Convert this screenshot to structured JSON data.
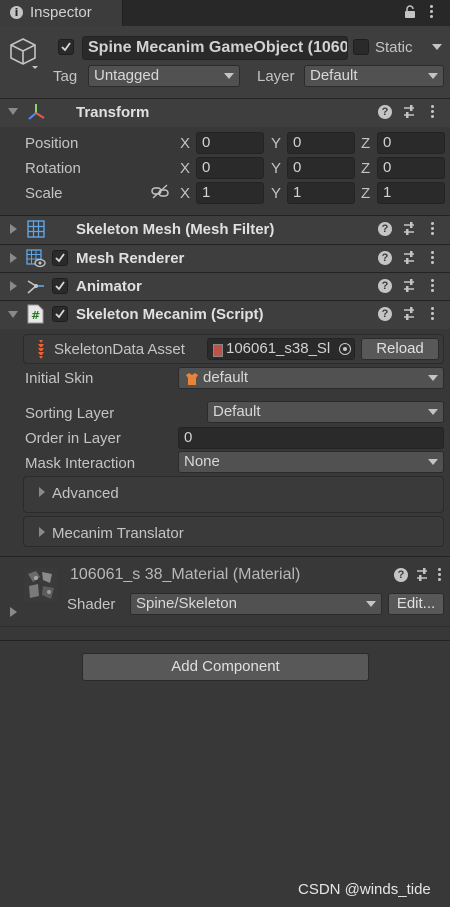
{
  "tab": {
    "title": "Inspector",
    "icon": "info-icon"
  },
  "tab_controls": {
    "lock_icon": "lock-icon",
    "menu_icon": "kebab-menu-icon"
  },
  "gameobject": {
    "name": "Spine Mecanim GameObject (1060",
    "static_label": "Static",
    "tag_label": "Tag",
    "tag_value": "Untagged",
    "layer_label": "Layer",
    "layer_value": "Default"
  },
  "transform": {
    "title": "Transform",
    "position_label": "Position",
    "rotation_label": "Rotation",
    "scale_label": "Scale",
    "x": "X",
    "y": "Y",
    "z": "Z",
    "position": [
      "0",
      "0",
      "0"
    ],
    "rotation": [
      "0",
      "0",
      "0"
    ],
    "scale": [
      "1",
      "1",
      "1"
    ]
  },
  "components": {
    "mesh_filter": "Skeleton Mesh (Mesh Filter)",
    "mesh_renderer": "Mesh Renderer",
    "animator": "Animator",
    "skeleton_mecanim": "Skeleton Mecanim (Script)"
  },
  "skeleton_mecanim": {
    "skeleton_data_label": "SkeletonData Asset",
    "skeleton_data_value": "106061_s38_Sl",
    "reload_label": "Reload",
    "initial_skin_label": "Initial Skin",
    "initial_skin_value": "default",
    "sorting_layer_label": "Sorting Layer",
    "sorting_layer_value": "Default",
    "order_in_layer_label": "Order in Layer",
    "order_in_layer_value": "0",
    "mask_interaction_label": "Mask Interaction",
    "mask_interaction_value": "None",
    "advanced_label": "Advanced",
    "mecanim_translator_label": "Mecanim Translator"
  },
  "material": {
    "title": "106061_s 38_Material (Material)",
    "shader_label": "Shader",
    "shader_value": "Spine/Skeleton",
    "edit_label": "Edit..."
  },
  "add_component_label": "Add Component",
  "watermark": "CSDN @winds_tide",
  "colors": {
    "background": "#383838",
    "header": "#3e3e3e",
    "field": "#2a2a2a",
    "text": "#c4c4c4"
  }
}
